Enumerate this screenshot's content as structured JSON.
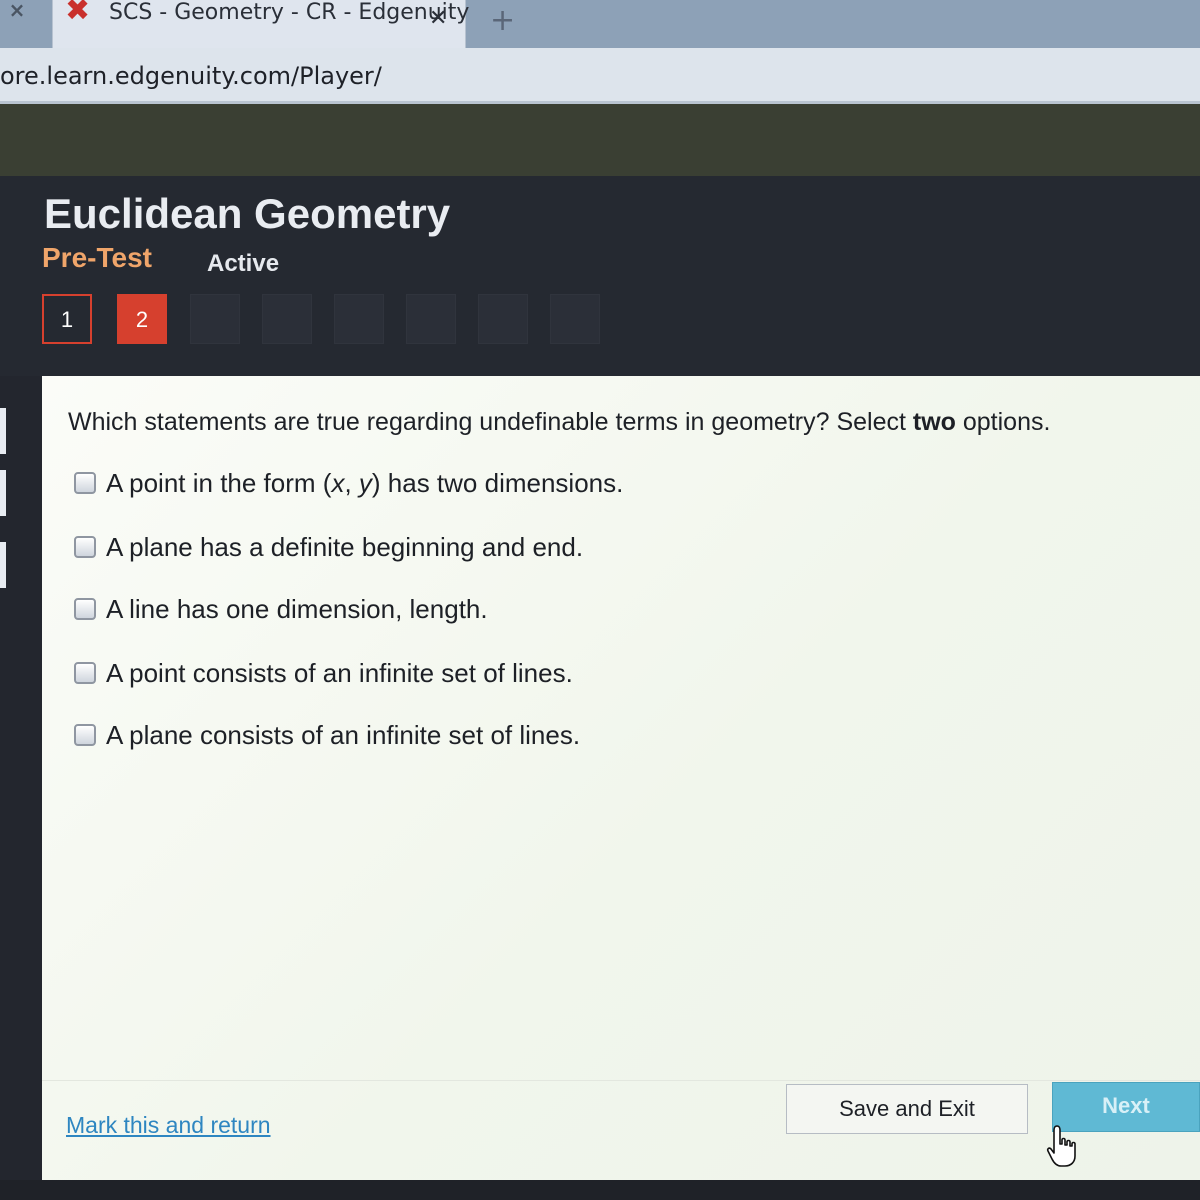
{
  "browser": {
    "tab_close_left": "×",
    "tab_icon": "✖",
    "tab_title": "SCS - Geometry - CR - Edgenuity",
    "tab_close": "✕",
    "new_tab": "+",
    "url": "ore.learn.edgenuity.com/Player/"
  },
  "header": {
    "course_title": "Euclidean Geometry",
    "activity_type": "Pre-Test",
    "activity_status": "Active",
    "question_nav": [
      {
        "label": "1",
        "state": "answered"
      },
      {
        "label": "2",
        "state": "current"
      }
    ]
  },
  "question": {
    "text_before": "Which statements are true regarding undefinable terms in geometry? Select ",
    "text_bold": "two",
    "text_after": " options.",
    "options": [
      {
        "pre": "A point in the form (",
        "x": "x",
        "mid": ", ",
        "y": "y",
        "post": ") has two dimensions."
      },
      {
        "text": "A plane has a definite beginning and end."
      },
      {
        "text": "A line has one dimension, length."
      },
      {
        "text": "A point consists of an infinite set of lines."
      },
      {
        "text": "A plane consists of an infinite set of lines."
      }
    ]
  },
  "footer": {
    "mark_link": "Mark this and return",
    "save_label": "Save and Exit",
    "next_label": "Next"
  },
  "colors": {
    "accent_red": "#d6402e",
    "activity_orange": "#f0a56a",
    "link_blue": "#2e86c1",
    "next_blue": "#5fb9d4"
  }
}
